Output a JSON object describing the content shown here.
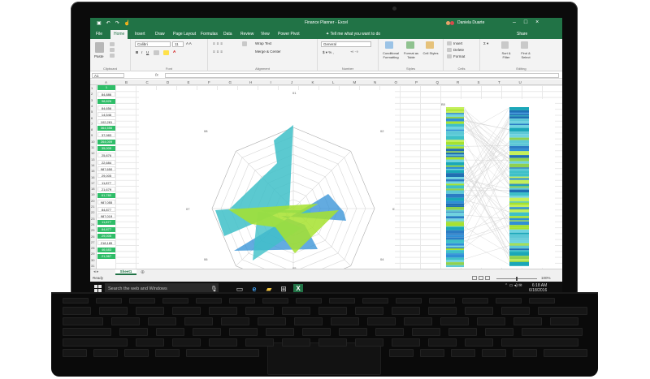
{
  "window": {
    "title": "Finance Planner - Excel",
    "user": "Daniela Duarte"
  },
  "ribbon_tabs": [
    {
      "label": "File"
    },
    {
      "label": "Home"
    },
    {
      "label": "Insert"
    },
    {
      "label": "Draw"
    },
    {
      "label": "Page Layout"
    },
    {
      "label": "Formulas"
    },
    {
      "label": "Data"
    },
    {
      "label": "Review"
    },
    {
      "label": "View"
    },
    {
      "label": "Power Pivot"
    }
  ],
  "tell_me": "Tell me what you want to do",
  "share": "Share",
  "ribbon": {
    "clipboard": {
      "label": "Clipboard",
      "paste": "Paste"
    },
    "font": {
      "label": "Font",
      "name": "Calibri",
      "size": "11"
    },
    "alignment": {
      "label": "Alignment",
      "wrap": "Wrap Text",
      "merge": "Merge & Center"
    },
    "number": {
      "label": "Number",
      "format": "General"
    },
    "styles": {
      "label": "Styles",
      "conditional": "Conditional Formatting",
      "format_table": "Format as Table",
      "cell_styles": "Cell Styles"
    },
    "cells": {
      "label": "Cells",
      "insert": "Insert",
      "delete": "Delete",
      "format": "Format"
    },
    "editing": {
      "label": "Editing",
      "sort": "Sort & Filter",
      "find": "Find & Select"
    }
  },
  "name_box": "A1",
  "fx": "fx",
  "columns": [
    "A",
    "B",
    "C",
    "D",
    "E",
    "F",
    "G",
    "H",
    "I",
    "J",
    "K",
    "L",
    "M",
    "N",
    "O",
    "P",
    "Q",
    "R",
    "S",
    "T",
    "U"
  ],
  "cell_values": [
    "1",
    "84,886",
    "98,826",
    "84,656",
    "14,546",
    "102,281",
    "364,556",
    "37,983",
    "264,009",
    "35,005",
    "25,876",
    "22,684",
    "987,650",
    "29,005",
    "11,877",
    "21,679",
    "61,780",
    "987,055",
    "84,877",
    "987,019",
    "11,877",
    "84,877",
    "29,005",
    "218,185",
    "46,683",
    "21,367"
  ],
  "radar": {
    "labels": [
      "01",
      "02",
      "03",
      "04",
      "05",
      "06",
      "07",
      "08"
    ]
  },
  "sheet_tab": "Sheet1",
  "status": {
    "ready": "Ready",
    "zoom": "100%"
  },
  "taskbar": {
    "search_placeholder": "Search the web and Windows",
    "time": "6:18 AM",
    "date": "6/18/2016"
  },
  "colors": {
    "excel_green": "#217346",
    "cell_green": "#2fbd68",
    "radar_blue": "#2f8fd6",
    "radar_teal": "#3ec0c8",
    "radar_lime": "#a6e22e"
  }
}
